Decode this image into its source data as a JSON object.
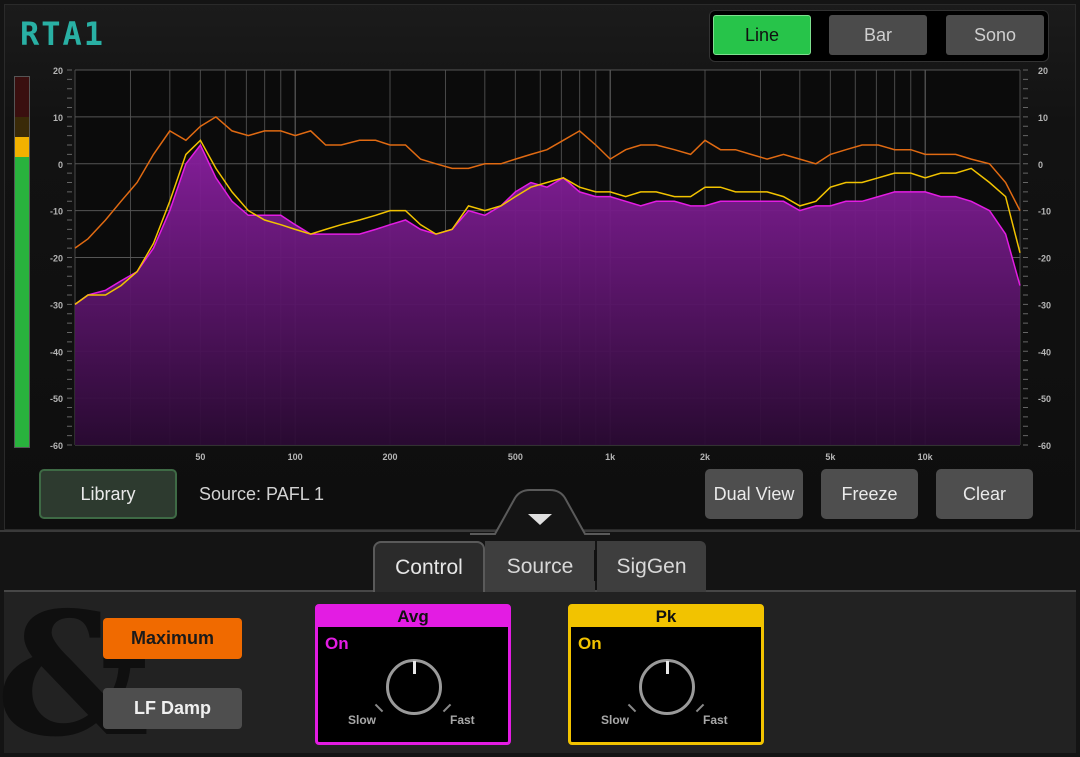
{
  "app": {
    "title": "RTA1"
  },
  "modes": {
    "line": "Line",
    "bar": "Bar",
    "sono": "Sono",
    "active": "Line"
  },
  "colors": {
    "avg": "#e31ce3",
    "pk": "#f2c300",
    "max": "#e06a12",
    "accent": "#27c44a",
    "logo": "#29b0a4"
  },
  "chart_data": {
    "type": "line",
    "xscale": "log",
    "xlim": [
      20,
      20000
    ],
    "ylim": [
      -60,
      20
    ],
    "yticks": [
      "20",
      "10",
      "0",
      "-10",
      "-20",
      "-30",
      "-40",
      "-50",
      "-60"
    ],
    "xtick_labels": [
      "50",
      "100",
      "200",
      "500",
      "1k",
      "2k",
      "5k",
      "10k"
    ],
    "x": [
      20,
      22,
      25,
      28,
      31.5,
      35.5,
      40,
      45,
      50,
      56,
      63,
      71,
      80,
      90,
      100,
      112,
      125,
      140,
      160,
      180,
      200,
      224,
      250,
      280,
      315,
      355,
      400,
      450,
      500,
      560,
      630,
      710,
      800,
      900,
      1000,
      1120,
      1250,
      1400,
      1600,
      1800,
      2000,
      2240,
      2500,
      2800,
      3150,
      3550,
      4000,
      4500,
      5000,
      5600,
      6300,
      7100,
      8000,
      9000,
      10000,
      11200,
      12500,
      14000,
      16000,
      18000,
      20000
    ],
    "series": [
      {
        "values": [
          -30,
          -28,
          -27,
          -25,
          -23,
          -18,
          -10,
          0,
          4,
          -3,
          -8,
          -11,
          -11,
          -11,
          -13,
          -15,
          -15,
          -15,
          -15,
          -14,
          -13,
          -12,
          -14,
          -15,
          -14,
          -10,
          -11,
          -9,
          -6,
          -4,
          -5,
          -3,
          -6,
          -7,
          -7,
          -8,
          -9,
          -8,
          -8,
          -9,
          -9,
          -8,
          -8,
          -8,
          -8,
          -8,
          -10,
          -9,
          -9,
          -8,
          -8,
          -7,
          -6,
          -6,
          -6,
          -7,
          -7,
          -8,
          -10,
          -15,
          -26
        ]
      },
      {
        "values": [
          -30,
          -28,
          -28,
          -26,
          -23,
          -17,
          -8,
          2,
          5,
          -1,
          -6,
          -10,
          -12,
          -13,
          -14,
          -15,
          -14,
          -13,
          -12,
          -11,
          -10,
          -10,
          -13,
          -15,
          -14,
          -9,
          -10,
          -9,
          -7,
          -5,
          -4,
          -3,
          -5,
          -6,
          -6,
          -7,
          -6,
          -6,
          -7,
          -7,
          -5,
          -5,
          -6,
          -6,
          -6,
          -7,
          -9,
          -8,
          -5,
          -4,
          -4,
          -3,
          -2,
          -2,
          -3,
          -2,
          -2,
          -1,
          -4,
          -7,
          -19
        ]
      },
      {
        "values": [
          -18,
          -16,
          -12,
          -8,
          -4,
          2,
          7,
          5,
          8,
          10,
          7,
          6,
          7,
          7,
          6,
          7,
          4,
          4,
          5,
          5,
          4,
          4,
          1,
          0,
          -1,
          -1,
          0,
          0,
          1,
          2,
          3,
          5,
          7,
          4,
          1,
          3,
          4,
          4,
          3,
          2,
          5,
          3,
          3,
          2,
          1,
          2,
          1,
          0,
          2,
          3,
          4,
          4,
          3,
          3,
          2,
          2,
          2,
          1,
          0,
          -4,
          -10
        ]
      }
    ]
  },
  "buttons": {
    "library": "Library",
    "source": "Source: PAFL 1",
    "dual_view": "Dual View",
    "freeze": "Freeze",
    "clear": "Clear"
  },
  "tabs": {
    "control": "Control",
    "source": "Source",
    "siggen": "SigGen",
    "active": "Control"
  },
  "controls": {
    "maximum": "Maximum",
    "lf_damp": "LF Damp",
    "avg": {
      "title": "Avg",
      "state": "On",
      "slow": "Slow",
      "fast": "Fast"
    },
    "pk": {
      "title": "Pk",
      "state": "On",
      "slow": "Slow",
      "fast": "Fast"
    }
  },
  "logo_glyph": "&"
}
